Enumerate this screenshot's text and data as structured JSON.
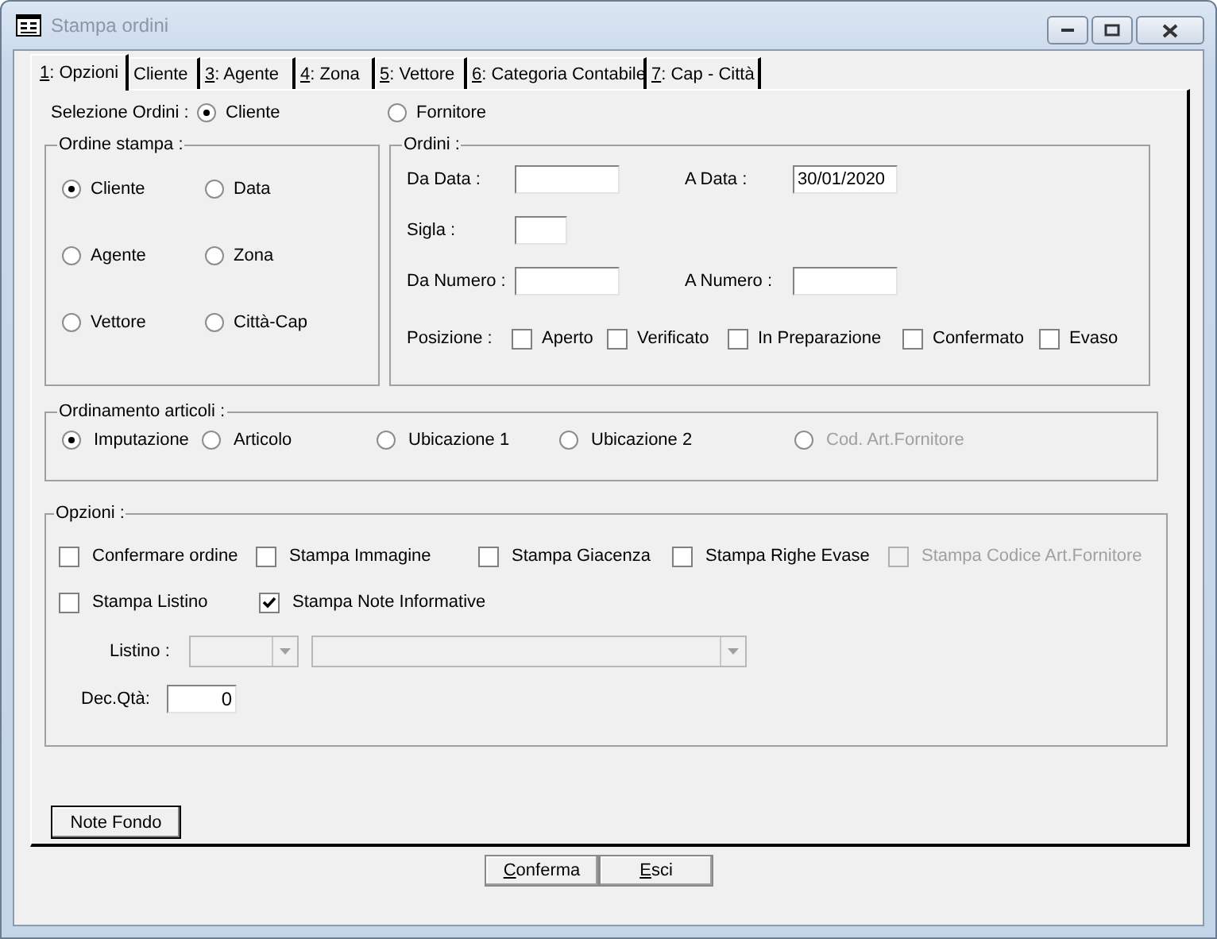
{
  "window": {
    "title": "Stampa ordini",
    "active": false
  },
  "tabs": [
    {
      "label": "1: Opzioni",
      "shortcut": true,
      "selected": true
    },
    {
      "label": "Cliente",
      "shortcut": false,
      "selected": false
    },
    {
      "label": "3: Agente",
      "shortcut": true,
      "selected": false
    },
    {
      "label": "4: Zona",
      "shortcut": true,
      "selected": false
    },
    {
      "label": "5: Vettore",
      "shortcut": true,
      "selected": false
    },
    {
      "label": "6: Categoria Contabile",
      "shortcut": true,
      "selected": false
    },
    {
      "label": "7: Cap - Città",
      "shortcut": true,
      "selected": false
    }
  ],
  "selezione_ordini": {
    "label": "Selezione  Ordini :",
    "options": [
      {
        "label": "Cliente",
        "selected": true
      },
      {
        "label": "Fornitore",
        "selected": false
      }
    ]
  },
  "ordine_stampa": {
    "title": "Ordine stampa :",
    "options": [
      {
        "label": "Cliente",
        "selected": true
      },
      {
        "label": "Data",
        "selected": false
      },
      {
        "label": "Agente",
        "selected": false
      },
      {
        "label": "Zona",
        "selected": false
      },
      {
        "label": "Vettore",
        "selected": false
      },
      {
        "label": "Città-Cap",
        "selected": false
      }
    ]
  },
  "ordini": {
    "title": "Ordini :",
    "rows": [
      [
        {
          "label": "Da Data :"
        },
        {
          "label": "A Data :",
          "value": "30/01/2020"
        }
      ],
      [
        {
          "label": "Sigla :",
          "kind": "short"
        }
      ],
      [
        {
          "label": "Da Numero :"
        },
        {
          "label": "A Numero :"
        }
      ]
    ],
    "posizione_label": "Posizione :",
    "posizione": [
      {
        "label": "Aperto",
        "checked": false
      },
      {
        "label": "Verificato",
        "checked": false
      },
      {
        "label": "In Preparazione",
        "checked": false
      },
      {
        "label": "Confermato",
        "checked": false
      },
      {
        "label": "Evaso",
        "checked": false
      }
    ]
  },
  "ordinamento_articoli": {
    "title": "Ordinamento articoli :",
    "options": [
      {
        "label": "Imputazione",
        "selected": true,
        "disabled": false
      },
      {
        "label": "Articolo",
        "selected": false,
        "disabled": false
      },
      {
        "label": "Ubicazione 1",
        "selected": false,
        "disabled": false
      },
      {
        "label": "Ubicazione 2",
        "selected": false,
        "disabled": false
      },
      {
        "label": "Cod. Art.Fornitore",
        "selected": false,
        "disabled": true
      }
    ]
  },
  "opzioni": {
    "title": "Opzioni :",
    "checkboxes": [
      [
        {
          "label": "Confermare ordine",
          "checked": false,
          "disabled": false
        },
        {
          "label": "Stampa Immagine",
          "checked": false,
          "disabled": false
        },
        {
          "label": "Stampa Giacenza",
          "checked": false,
          "disabled": false
        },
        {
          "label": "Stampa Righe Evase",
          "checked": false,
          "disabled": false
        },
        {
          "label": "Stampa Codice Art.Fornitore",
          "checked": false,
          "disabled": true
        }
      ],
      [
        {
          "label": "Stampa Listino",
          "checked": false,
          "disabled": false
        },
        {
          "label": "Stampa Note Informative",
          "checked": true,
          "disabled": false
        }
      ]
    ],
    "listino_label": "Listino :",
    "listino_disabled": true,
    "dec_qta_label": "Dec.Qtà:",
    "dec_qta_value": "0"
  },
  "note_fondo_button": "Note Fondo",
  "buttons": [
    {
      "label": "Conferma",
      "shortcut": true
    },
    {
      "label": "Esci",
      "shortcut": true
    }
  ]
}
